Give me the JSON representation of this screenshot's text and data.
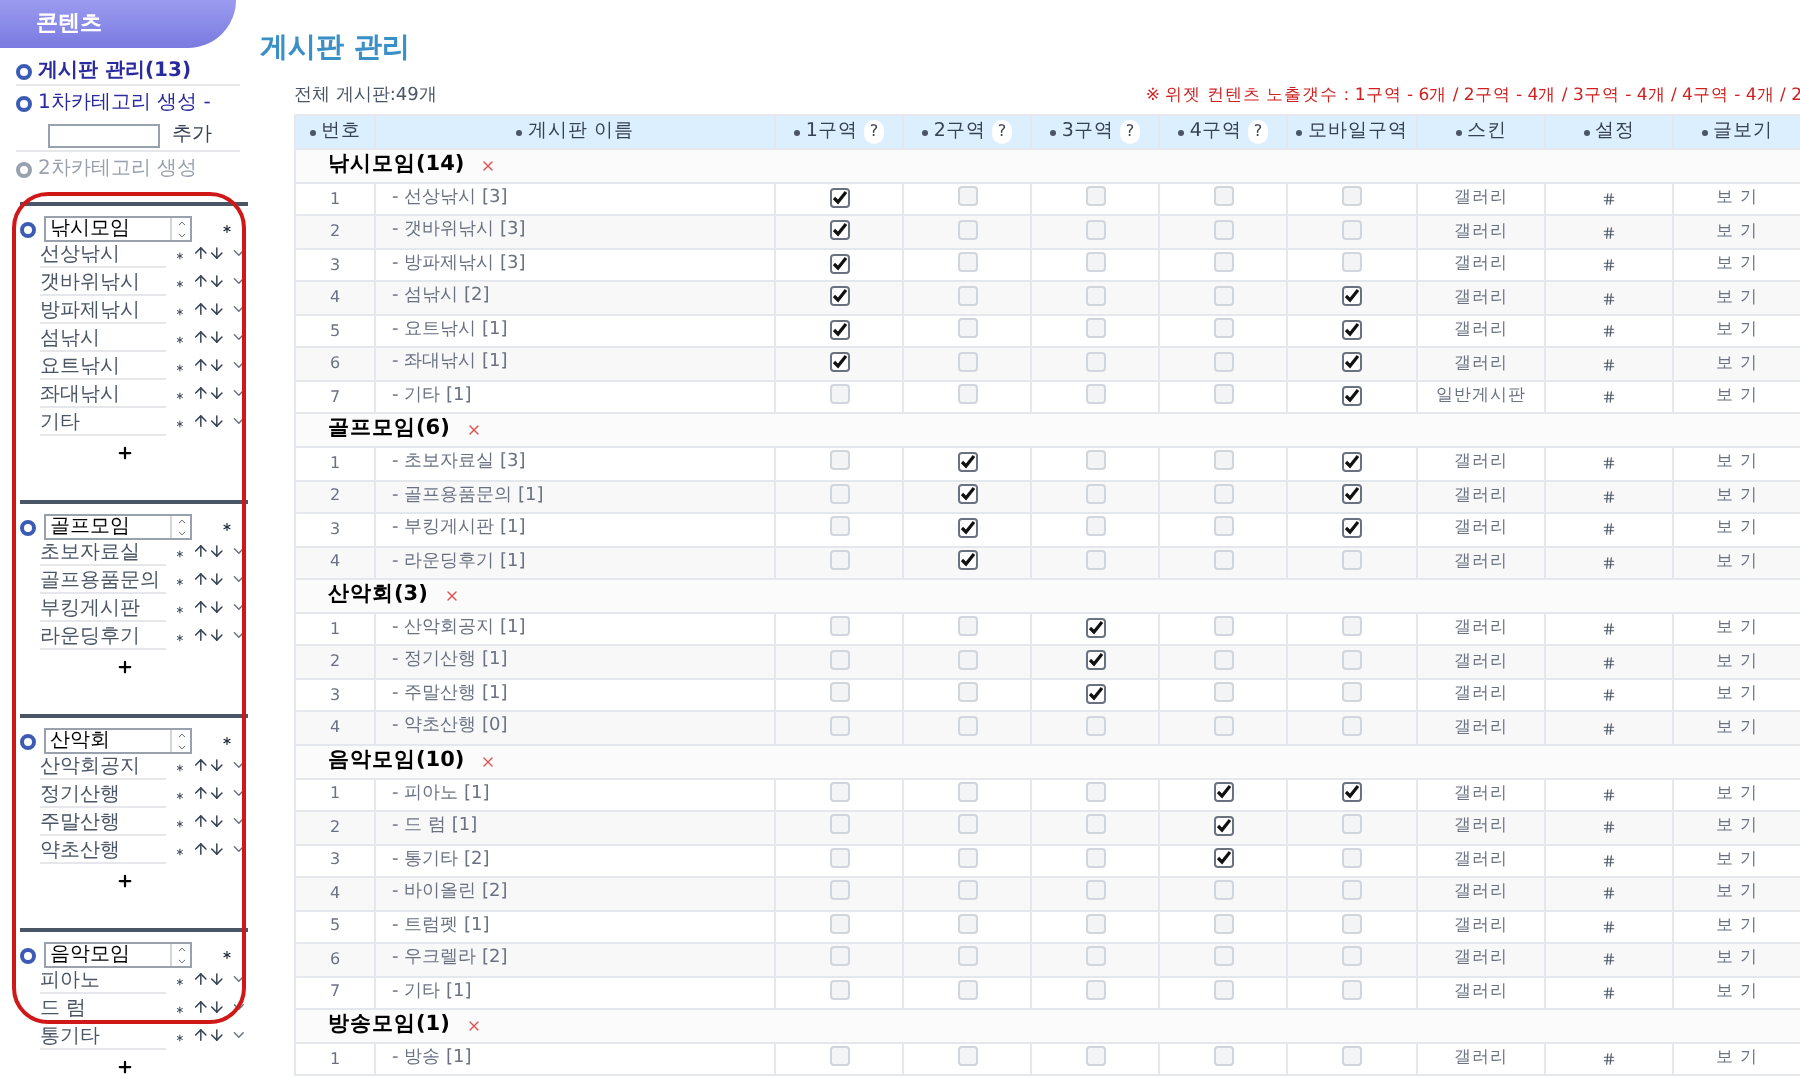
{
  "sidebar": {
    "header": "콘텐츠",
    "board_manage": "게시판 관리(13)",
    "category1": "1차카테고리 생성 -",
    "add_button": "추가",
    "category2": "2차카테고리 생성",
    "groups": [
      {
        "name": "낚시모임",
        "items": [
          "선상낚시",
          "갯바위낚시",
          "방파제낚시",
          "섬낚시",
          "요트낚시",
          "좌대낚시",
          "기타"
        ]
      },
      {
        "name": "골프모임",
        "items": [
          "초보자료실",
          "골프용품문의",
          "부킹게시판",
          "라운딩후기"
        ]
      },
      {
        "name": "산악회",
        "items": [
          "산악회공지",
          "정기산행",
          "주말산행",
          "약초산행"
        ]
      },
      {
        "name": "음악모임",
        "items": [
          "피아노",
          "드 럼",
          "통기타"
        ]
      }
    ]
  },
  "title": "게시판 관리",
  "total": "전체 게시판:49개",
  "notice": "※ 위젯 컨텐츠 노출갯수 : 1구역 - 6개 / 2구역 - 4개 / 3구역 - 4개 / 4구역 - 4개 / 2",
  "table": {
    "columns": [
      {
        "label": "번호"
      },
      {
        "label": "게시판 이름"
      },
      {
        "label": "1구역",
        "help": "?"
      },
      {
        "label": "2구역",
        "help": "?"
      },
      {
        "label": "3구역",
        "help": "?"
      },
      {
        "label": "4구역",
        "help": "?"
      },
      {
        "label": "모바일구역"
      },
      {
        "label": "스킨"
      },
      {
        "label": "설정"
      },
      {
        "label": "글보기"
      }
    ],
    "groups": [
      {
        "title": "낚시모임(14)",
        "rows": [
          {
            "no": "1",
            "name": "- 선상낚시 [3]",
            "zones": [
              true,
              false,
              false,
              false
            ],
            "mobile": false,
            "skin": "갤러리",
            "view": "보 기"
          },
          {
            "no": "2",
            "name": "- 갯바위낚시 [3]",
            "zones": [
              true,
              false,
              false,
              false
            ],
            "mobile": false,
            "skin": "갤러리",
            "view": "보 기"
          },
          {
            "no": "3",
            "name": "- 방파제낚시 [3]",
            "zones": [
              true,
              false,
              false,
              false
            ],
            "mobile": false,
            "skin": "갤러리",
            "view": "보 기"
          },
          {
            "no": "4",
            "name": "- 섬낚시 [2]",
            "zones": [
              true,
              false,
              false,
              false
            ],
            "mobile": true,
            "skin": "갤러리",
            "view": "보 기"
          },
          {
            "no": "5",
            "name": "- 요트낚시 [1]",
            "zones": [
              true,
              false,
              false,
              false
            ],
            "mobile": true,
            "skin": "갤러리",
            "view": "보 기"
          },
          {
            "no": "6",
            "name": "- 좌대낚시 [1]",
            "zones": [
              true,
              false,
              false,
              false
            ],
            "mobile": true,
            "skin": "갤러리",
            "view": "보 기"
          },
          {
            "no": "7",
            "name": "- 기타 [1]",
            "zones": [
              false,
              false,
              false,
              false
            ],
            "mobile": true,
            "skin": "일반게시판",
            "view": "보 기"
          }
        ]
      },
      {
        "title": "골프모임(6)",
        "rows": [
          {
            "no": "1",
            "name": "- 초보자료실 [3]",
            "zones": [
              false,
              true,
              false,
              false
            ],
            "mobile": true,
            "skin": "갤러리",
            "view": "보 기"
          },
          {
            "no": "2",
            "name": "- 골프용품문의 [1]",
            "zones": [
              false,
              true,
              false,
              false
            ],
            "mobile": true,
            "skin": "갤러리",
            "view": "보 기"
          },
          {
            "no": "3",
            "name": "- 부킹게시판 [1]",
            "zones": [
              false,
              true,
              false,
              false
            ],
            "mobile": true,
            "skin": "갤러리",
            "view": "보 기"
          },
          {
            "no": "4",
            "name": "- 라운딩후기 [1]",
            "zones": [
              false,
              true,
              false,
              false
            ],
            "mobile": false,
            "skin": "갤러리",
            "view": "보 기"
          }
        ]
      },
      {
        "title": "산악회(3)",
        "rows": [
          {
            "no": "1",
            "name": "- 산악회공지 [1]",
            "zones": [
              false,
              false,
              true,
              false
            ],
            "mobile": false,
            "skin": "갤러리",
            "view": "보 기"
          },
          {
            "no": "2",
            "name": "- 정기산행 [1]",
            "zones": [
              false,
              false,
              true,
              false
            ],
            "mobile": false,
            "skin": "갤러리",
            "view": "보 기"
          },
          {
            "no": "3",
            "name": "- 주말산행 [1]",
            "zones": [
              false,
              false,
              true,
              false
            ],
            "mobile": false,
            "skin": "갤러리",
            "view": "보 기"
          },
          {
            "no": "4",
            "name": "- 약초산행 [0]",
            "zones": [
              false,
              false,
              false,
              false
            ],
            "mobile": false,
            "skin": "갤러리",
            "view": "보 기"
          }
        ]
      },
      {
        "title": "음악모임(10)",
        "rows": [
          {
            "no": "1",
            "name": "- 피아노 [1]",
            "zones": [
              false,
              false,
              false,
              true
            ],
            "mobile": true,
            "skin": "갤러리",
            "view": "보 기"
          },
          {
            "no": "2",
            "name": "- 드 럼 [1]",
            "zones": [
              false,
              false,
              false,
              true
            ],
            "mobile": false,
            "skin": "갤러리",
            "view": "보 기"
          },
          {
            "no": "3",
            "name": "- 통기타 [2]",
            "zones": [
              false,
              false,
              false,
              true
            ],
            "mobile": false,
            "skin": "갤러리",
            "view": "보 기"
          },
          {
            "no": "4",
            "name": "- 바이올린 [2]",
            "zones": [
              false,
              false,
              false,
              false
            ],
            "mobile": false,
            "skin": "갤러리",
            "view": "보 기"
          },
          {
            "no": "5",
            "name": "- 트럼펫 [1]",
            "zones": [
              false,
              false,
              false,
              false
            ],
            "mobile": false,
            "skin": "갤러리",
            "view": "보 기"
          },
          {
            "no": "6",
            "name": "- 우크렐라 [2]",
            "zones": [
              false,
              false,
              false,
              false
            ],
            "mobile": false,
            "skin": "갤러리",
            "view": "보 기"
          },
          {
            "no": "7",
            "name": "- 기타 [1]",
            "zones": [
              false,
              false,
              false,
              false
            ],
            "mobile": false,
            "skin": "갤러리",
            "view": "보 기"
          }
        ]
      },
      {
        "title": "방송모임(1)",
        "rows": [
          {
            "no": "1",
            "name": "- 방송 [1]",
            "zones": [
              false,
              false,
              false,
              false
            ],
            "mobile": false,
            "skin": "갤러리",
            "view": "보 기"
          }
        ]
      }
    ]
  }
}
